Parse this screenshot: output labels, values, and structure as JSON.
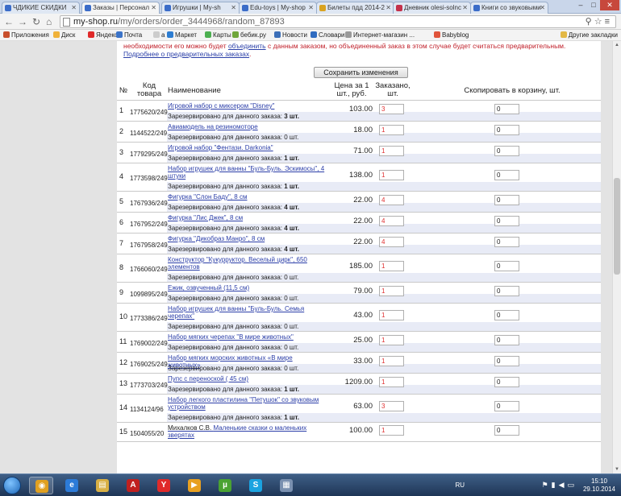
{
  "tabs": [
    {
      "label": "ЧДИКИЕ СКИДКИ",
      "color": "#3b6cc8",
      "active": false
    },
    {
      "label": "Заказы | Персонал",
      "color": "#3b6cc8",
      "active": true
    },
    {
      "label": "Игрушки | My-sh",
      "color": "#3b6cc8",
      "active": false
    },
    {
      "label": "Edu-toys | My-shop",
      "color": "#3b6cc8",
      "active": false
    },
    {
      "label": "Билеты пдд 2014-2",
      "color": "#d9a321",
      "active": false
    },
    {
      "label": "Дневник olesi-solnc",
      "color": "#c4314b",
      "active": false
    },
    {
      "label": "Книги со звуковыми",
      "color": "#3b6cc8",
      "active": false
    }
  ],
  "address": {
    "host": "my-shop.ru",
    "path": "/my/orders/order_3444968/random_87893"
  },
  "bookmarks": [
    {
      "label": "Приложения",
      "color": "#c84f2c"
    },
    {
      "label": "Диск",
      "color": "#f0b23a"
    },
    {
      "label": "Яндекс",
      "color": "#e02a2a"
    },
    {
      "label": "Почта",
      "color": "#3b73c8"
    },
    {
      "label": "a",
      "color": "#cccccc"
    },
    {
      "label": "Маркет",
      "color": "#2d7dd2"
    },
    {
      "label": "Карты",
      "color": "#4caf50"
    },
    {
      "label": "бебик.ру",
      "color": "#6fa63a"
    },
    {
      "label": "Новости",
      "color": "#3c6fb8"
    },
    {
      "label": "Словари",
      "color": "#2f6bc0"
    },
    {
      "label": "Интернет-магазин ...",
      "color": "#999999"
    },
    {
      "label": "Babyblog",
      "color": "#e0543b"
    }
  ],
  "bookmarks_other": "Другие закладки",
  "notice": {
    "part1": "необходимости его можно будет ",
    "link1": "объединить",
    "part2": " с данным заказом, но объединенный заказ в этом случае будет считаться предварительным. ",
    "link2": "Подробнее о предварительных заказах"
  },
  "save_button": "Сохранить изменения",
  "headers": {
    "num": "№",
    "code": "Код товара",
    "name": "Наименование",
    "price": "Цена за 1 шт., руб.",
    "ordered": "Заказано, шт.",
    "copy": "Скопировать в корзину, шт."
  },
  "rows": [
    {
      "num": "1",
      "code": "1775620/249",
      "name": "Игровой набор с миксером \"Disney\"",
      "reserved_text": "Зарезервировано для данного заказа: ",
      "reserved": "3 шт.",
      "bold": true,
      "price": "103.00",
      "qty": "3",
      "copy": "0"
    },
    {
      "num": "2",
      "code": "1144522/249",
      "name": "Авиамодель на резиномоторе",
      "reserved_text": "Зарезервировано для данного заказа: ",
      "reserved": "0 шт.",
      "bold": false,
      "price": "18.00",
      "qty": "1",
      "copy": "0"
    },
    {
      "num": "3",
      "code": "1779295/249",
      "name": "Игровой набор \"Фентази. Darkonia\"",
      "reserved_text": "Зарезервировано для данного заказа: ",
      "reserved": "1 шт.",
      "bold": true,
      "price": "71.00",
      "qty": "1",
      "copy": "0"
    },
    {
      "num": "4",
      "code": "1773598/249",
      "name": "Набор игрушек для ванны \"Буль-Буль. Эскимосы\", 4 штуки",
      "reserved_text": "Зарезервировано для данного заказа: ",
      "reserved": "1 шт.",
      "bold": true,
      "price": "138.00",
      "qty": "1",
      "copy": "0"
    },
    {
      "num": "5",
      "code": "1767936/249",
      "name": "Фигурка \"Слон Баду\", 8 см",
      "reserved_text": "Зарезервировано для данного заказа: ",
      "reserved": "4 шт.",
      "bold": true,
      "price": "22.00",
      "qty": "4",
      "copy": "0"
    },
    {
      "num": "6",
      "code": "1767952/249",
      "name": "Фигурка \"Лис Джек\", 8 см",
      "reserved_text": "Зарезервировано для данного заказа: ",
      "reserved": "4 шт.",
      "bold": true,
      "price": "22.00",
      "qty": "4",
      "copy": "0"
    },
    {
      "num": "7",
      "code": "1767958/249",
      "name": "Фигурка \"Дикобраз Манро\", 8 см",
      "reserved_text": "Зарезервировано для данного заказа: ",
      "reserved": "4 шт.",
      "bold": true,
      "price": "22.00",
      "qty": "4",
      "copy": "0"
    },
    {
      "num": "8",
      "code": "1766060/249",
      "name": "Конструктор \"Кукурруктор. Веселый цирк\", 650 элементов",
      "reserved_text": "Зарезервировано для данного заказа: ",
      "reserved": "0 шт.",
      "bold": false,
      "price": "185.00",
      "qty": "1",
      "copy": "0"
    },
    {
      "num": "9",
      "code": "1099895/249",
      "name": "Ежик, озвученный (11,5 см)",
      "reserved_text": "Зарезервировано для данного заказа: ",
      "reserved": "0 шт.",
      "bold": false,
      "price": "79.00",
      "qty": "1",
      "copy": "0"
    },
    {
      "num": "10",
      "code": "1773386/249",
      "name": "Набор игрушек для ванны \"Буль-Буль. Семья черепах\"",
      "reserved_text": "Зарезервировано для данного заказа: ",
      "reserved": "0 шт.",
      "bold": false,
      "price": "43.00",
      "qty": "1",
      "copy": "0"
    },
    {
      "num": "11",
      "code": "1769002/249",
      "name": "Набор мягких черепах \"В мире животных\"",
      "reserved_text": "Зарезервировано для данного заказа: ",
      "reserved": "0 шт.",
      "bold": false,
      "price": "25.00",
      "qty": "1",
      "copy": "0"
    },
    {
      "num": "12",
      "code": "1769025/249",
      "name": "Набор мягких морских животных «В мире животных»",
      "reserved_text": "Зарезервировано для данного заказа: ",
      "reserved": "0 шт.",
      "bold": false,
      "price": "33.00",
      "qty": "1",
      "copy": "0"
    },
    {
      "num": "13",
      "code": "1773703/249",
      "name": "Пупс с переноской ( 45 см)",
      "reserved_text": "Зарезервировано для данного заказа: ",
      "reserved": "1 шт.",
      "bold": true,
      "price": "1209.00",
      "qty": "1",
      "copy": "0"
    },
    {
      "num": "14",
      "code": "1134124/96",
      "name": "Набор легкого пластилина \"Петушок\" со звуковым устройством",
      "reserved_text": "Зарезервировано для данного заказа: ",
      "reserved": "1 шт.",
      "bold": true,
      "price": "63.00",
      "qty": "3",
      "copy": "0"
    },
    {
      "num": "15",
      "code": "1504055/20",
      "name_prefix": "Михалков С.В. ",
      "name": "Маленькие сказки о маленьких зверятах",
      "reserved_text": "",
      "reserved": "",
      "bold": false,
      "price": "100.00",
      "qty": "1",
      "copy": "0"
    }
  ],
  "taskbar": {
    "apps": [
      {
        "name": "chrome",
        "color": "#e0a020",
        "glyph": "◉"
      },
      {
        "name": "ie",
        "color": "#2c7bd8",
        "glyph": "e"
      },
      {
        "name": "explorer",
        "color": "#d8b045",
        "glyph": "▤"
      },
      {
        "name": "pdf",
        "color": "#c0201f",
        "glyph": "A"
      },
      {
        "name": "yandex",
        "color": "#e02a2a",
        "glyph": "Y"
      },
      {
        "name": "media",
        "color": "#e8a020",
        "glyph": "▶"
      },
      {
        "name": "utorrent",
        "color": "#4aa232",
        "glyph": "µ"
      },
      {
        "name": "skype",
        "color": "#1aa3e0",
        "glyph": "S"
      },
      {
        "name": "window",
        "color": "#7a90b0",
        "glyph": "▦"
      }
    ],
    "lang": "RU",
    "time": "15:10",
    "date": "29.10.2014"
  }
}
